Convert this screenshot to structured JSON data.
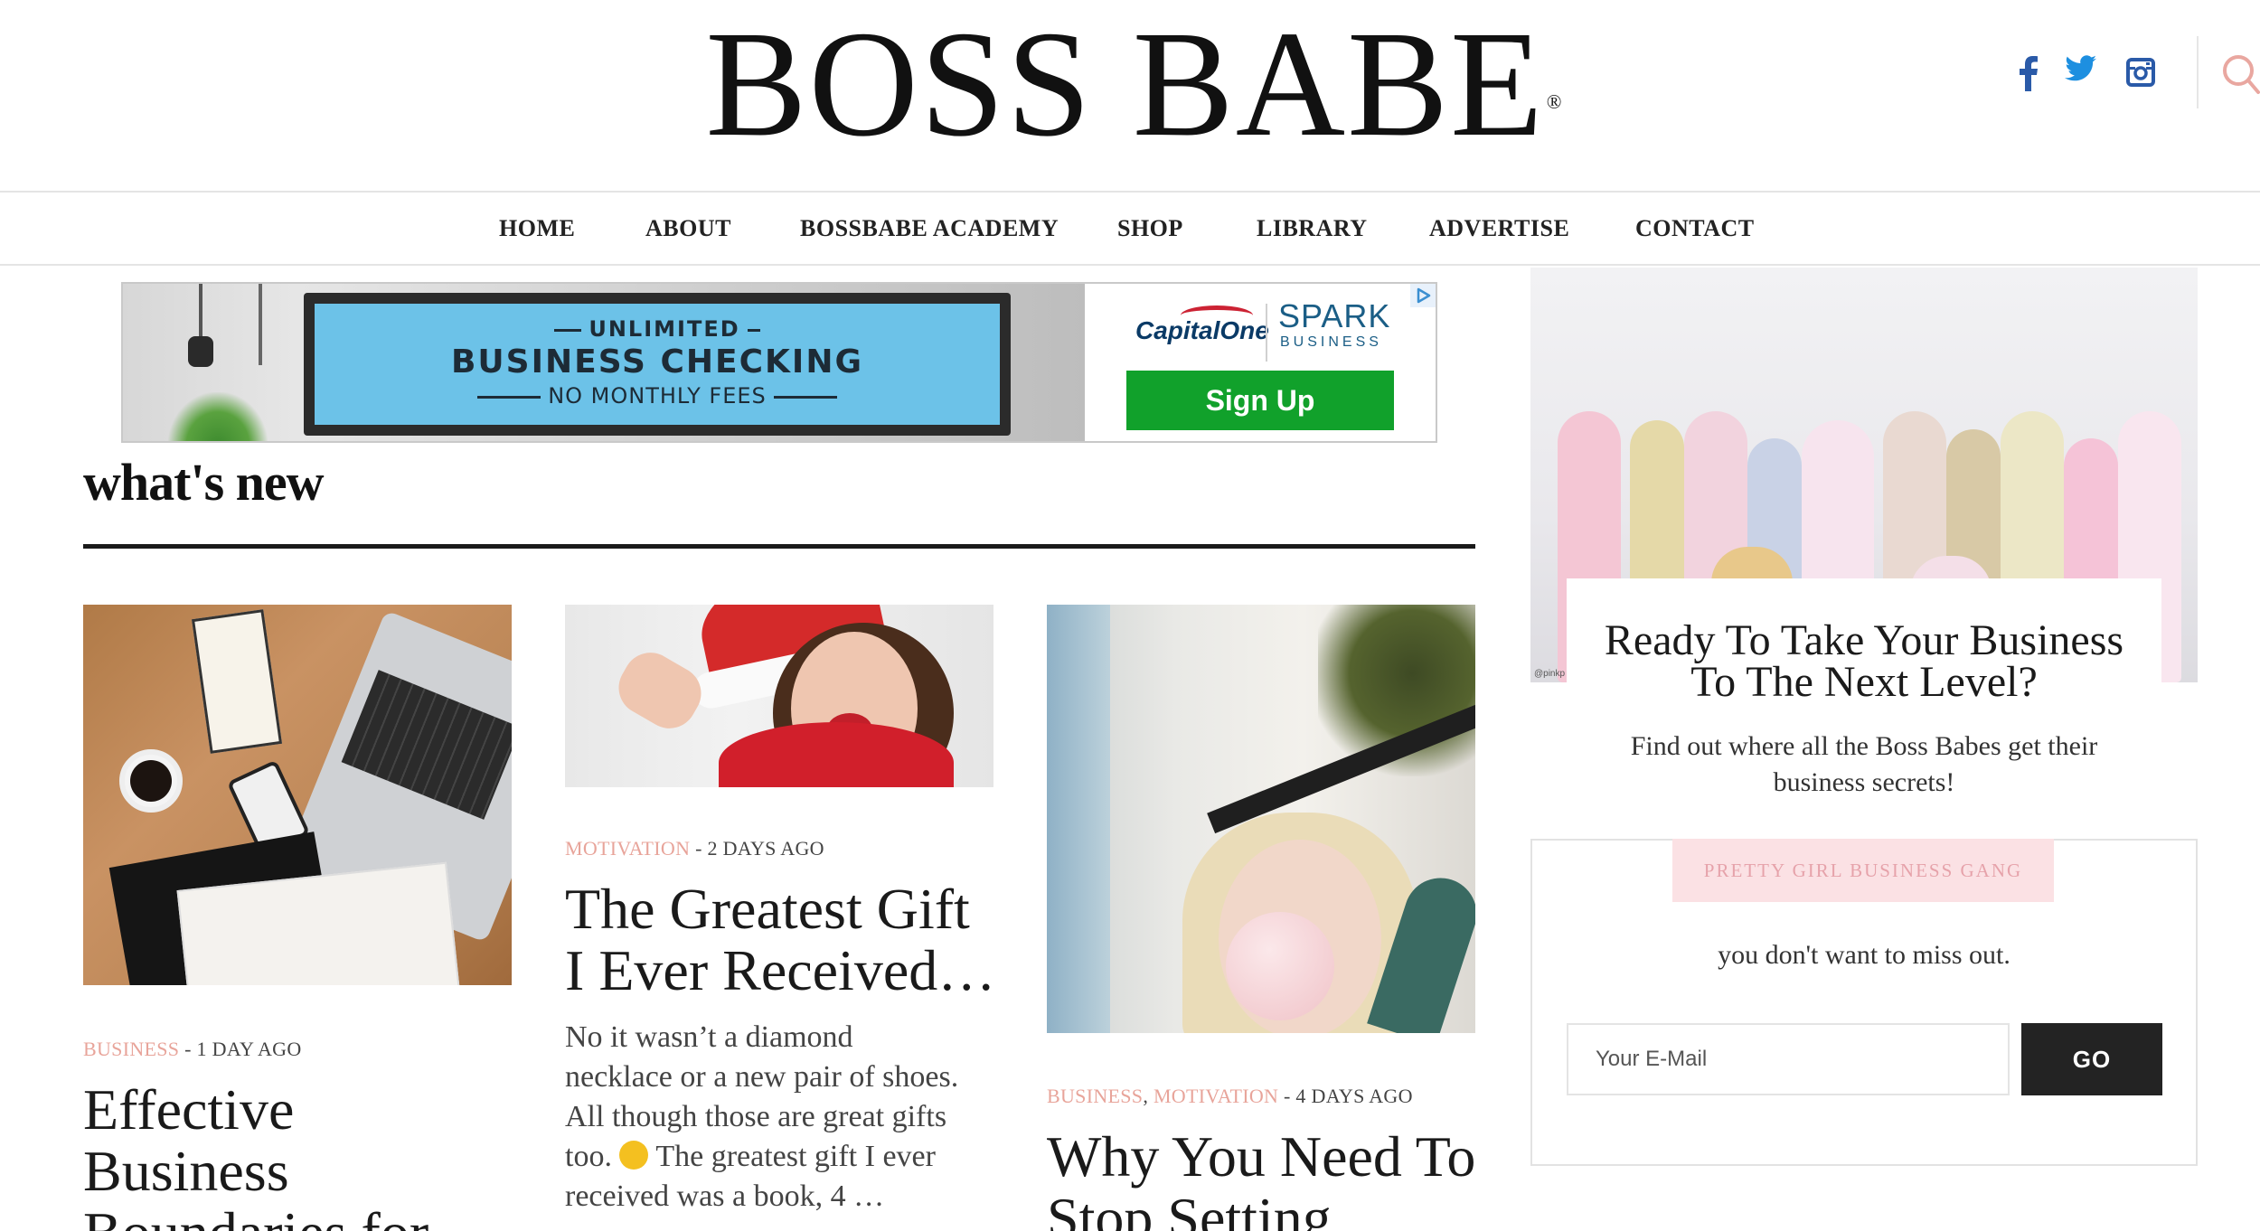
{
  "header": {
    "logo_text": "BOSS BABE",
    "logo_mark": "®",
    "social_icons": [
      "facebook-icon",
      "twitter-icon",
      "instagram-icon"
    ],
    "search_icon": "search-icon",
    "social_color": "#2a5aa8",
    "search_color": "#e9a7a0"
  },
  "nav": {
    "items": [
      {
        "label": "HOME"
      },
      {
        "label": "ABOUT"
      },
      {
        "label": "BOSSBABE ACADEMY"
      },
      {
        "label": "SHOP"
      },
      {
        "label": "LIBRARY"
      },
      {
        "label": "ADVERTISE"
      },
      {
        "label": "CONTACT"
      }
    ]
  },
  "ad": {
    "line1": "UNLIMITED",
    "line2": "BUSINESS CHECKING",
    "line3": "NO MONTHLY FEES",
    "brand": "CapitalOne",
    "product": "SPARK",
    "product_sub": "BUSINESS",
    "cta": "Sign Up",
    "cta_color": "#11a12b",
    "badge_icon": "adchoices-icon"
  },
  "section": {
    "title": "what's new"
  },
  "posts": [
    {
      "categories": [
        "BUSINESS"
      ],
      "date": " - 1 DAY AGO",
      "title": [
        "Effective",
        "Business",
        "Boundaries for"
      ]
    },
    {
      "categories": [
        "MOTIVATION"
      ],
      "date": " - 2 DAYS AGO",
      "title": [
        "The Greatest Gift",
        "I Ever Received…"
      ],
      "excerpt": [
        "No it wasn’t a diamond",
        "necklace or a new pair of shoes.",
        "All though those are great gifts",
        "too.",
        " The greatest gift I ever",
        "received was a book, 4 …"
      ]
    },
    {
      "categories": [
        "BUSINESS",
        "MOTIVATION"
      ],
      "separator": ", ",
      "date": " - 4 DAYS AGO",
      "title": [
        "Why You Need To",
        "Stop Setting"
      ]
    }
  ],
  "sidebar": {
    "promo_title": [
      "Ready To Take Your Business",
      "To The Next Level?"
    ],
    "promo_sub": [
      "Find out where all the Boss Babes get their",
      "business secrets!"
    ],
    "photo_credit": "@pinkp",
    "newsletter_label": "PRETTY GIRL BUSINESS GANG",
    "newsletter_text": "you don't want to miss out.",
    "email_placeholder": "Your E-Mail",
    "go_label": "GO",
    "accent_pink": "#e8a49a"
  }
}
